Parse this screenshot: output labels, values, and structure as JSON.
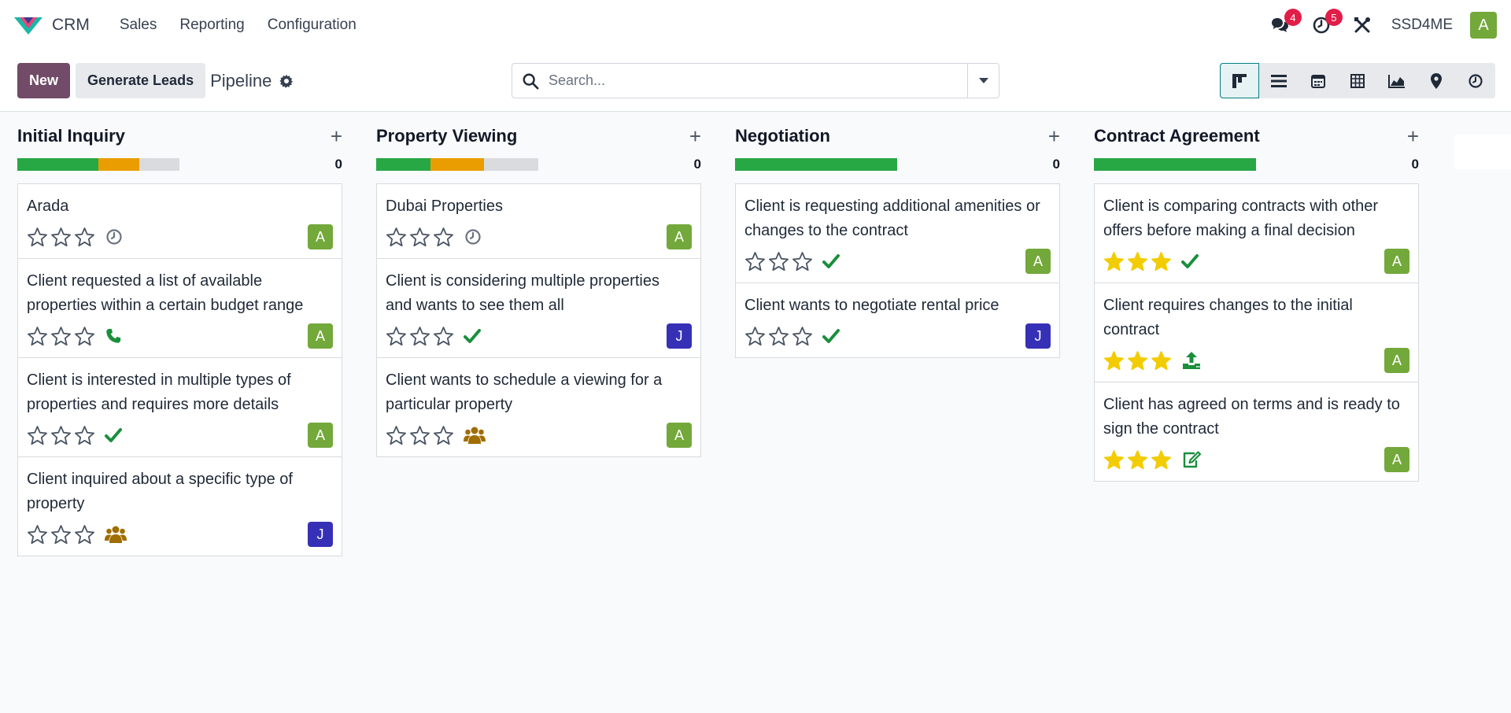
{
  "nav": {
    "app_name": "CRM",
    "menu": [
      "Sales",
      "Reporting",
      "Configuration"
    ],
    "messages_count": "4",
    "activities_count": "5",
    "company": "SSD4ME",
    "user_initial": "A",
    "icons": {
      "logo": "crm-logo-icon",
      "messages": "chat-icon",
      "activities": "clock-icon",
      "debug": "tools-icon"
    }
  },
  "control": {
    "new_label": "New",
    "generate_label": "Generate Leads",
    "breadcrumb": "Pipeline",
    "search_placeholder": "Search...",
    "views": [
      "kanban",
      "list",
      "calendar",
      "pivot",
      "graph",
      "map",
      "activity"
    ],
    "active_view": "kanban"
  },
  "colors": {
    "primary": "#714b67",
    "green": "#28a745",
    "orange": "#e99d00",
    "grey": "#d9dbde",
    "star_gold": "#f3cc00",
    "avatar_a": "#73a83a",
    "avatar_j": "#3630b6"
  },
  "columns": [
    {
      "title": "Initial Inquiry",
      "count": "0",
      "progress": {
        "green": 0.5,
        "orange": 0.25,
        "grey": 0.25
      },
      "cards": [
        {
          "title": "Arada",
          "stars": 0,
          "activity": "clock",
          "avatar": "A"
        },
        {
          "title": "Client requested a list of available properties within a certain budget range",
          "stars": 0,
          "activity": "phone",
          "avatar": "A"
        },
        {
          "title": "Client is interested in multiple types of properties and requires more details",
          "stars": 0,
          "activity": "check",
          "avatar": "A"
        },
        {
          "title": "Client inquired about a specific type of property",
          "stars": 0,
          "activity": "users",
          "avatar": "J"
        }
      ]
    },
    {
      "title": "Property Viewing",
      "count": "0",
      "progress": {
        "green": 0.333,
        "orange": 0.334,
        "grey": 0.333
      },
      "cards": [
        {
          "title": "Dubai Properties",
          "stars": 0,
          "activity": "clock",
          "avatar": "A"
        },
        {
          "title": "Client is considering multiple properties and wants to see them all",
          "stars": 0,
          "activity": "check",
          "avatar": "J"
        },
        {
          "title": "Client wants to schedule a viewing for a particular property",
          "stars": 0,
          "activity": "users",
          "avatar": "A"
        }
      ]
    },
    {
      "title": "Negotiation",
      "count": "0",
      "progress": {
        "green": 1,
        "orange": 0,
        "grey": 0
      },
      "cards": [
        {
          "title": "Client is requesting additional amenities or changes to the contract",
          "stars": 0,
          "activity": "check",
          "avatar": "A"
        },
        {
          "title": "Client wants to negotiate rental price",
          "stars": 0,
          "activity": "check",
          "avatar": "J"
        }
      ]
    },
    {
      "title": "Contract Agreement",
      "count": "0",
      "progress": {
        "green": 1,
        "orange": 0,
        "grey": 0
      },
      "cards": [
        {
          "title": "Client is comparing contracts with other offers before making a final decision",
          "stars": 3,
          "activity": "check",
          "avatar": "A"
        },
        {
          "title": "Client requires changes to the initial contract",
          "stars": 3,
          "activity": "upload",
          "avatar": "A"
        },
        {
          "title": "Client has agreed on terms and is ready to sign the contract",
          "stars": 3,
          "activity": "edit",
          "avatar": "A"
        }
      ]
    }
  ]
}
